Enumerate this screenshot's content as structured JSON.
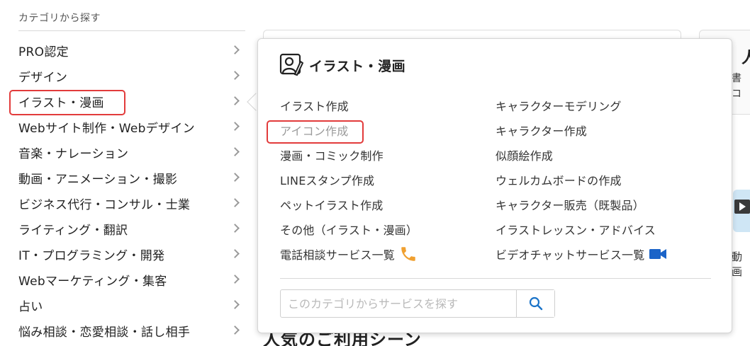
{
  "category_header": "カテゴリから探す",
  "categories": [
    {
      "label": "PRO認定"
    },
    {
      "label": "デザイン"
    },
    {
      "label": "イラスト・漫画",
      "active": true
    },
    {
      "label": "Webサイト制作・Webデザイン"
    },
    {
      "label": "音楽・ナレーション"
    },
    {
      "label": "動画・アニメーション・撮影"
    },
    {
      "label": "ビジネス代行・コンサル・士業"
    },
    {
      "label": "ライティング・翻訳"
    },
    {
      "label": "IT・プログラミング・開発"
    },
    {
      "label": "Webマーケティング・集客"
    },
    {
      "label": "占い"
    },
    {
      "label": "悩み相談・恋愛相談・話し相手"
    }
  ],
  "panel": {
    "title": "イラスト・漫画",
    "left_links": [
      {
        "label": "イラスト作成"
      },
      {
        "label": "アイコン作成"
      },
      {
        "label": "漫画・コミック制作"
      },
      {
        "label": "LINEスタンプ作成"
      },
      {
        "label": "ペットイラスト作成"
      },
      {
        "label": "その他（イラスト・漫画）"
      },
      {
        "label": "電話相談サービス一覧"
      }
    ],
    "right_links": [
      {
        "label": "キャラクターモデリング"
      },
      {
        "label": "キャラクター作成"
      },
      {
        "label": "似顔絵作成"
      },
      {
        "label": "ウェルカムボードの作成"
      },
      {
        "label": "キャラクター販売（既製品）"
      },
      {
        "label": "イラストレッスン・アドバイス"
      },
      {
        "label": "ビデオチャットサービス一覧"
      }
    ],
    "search": {
      "placeholder": "このカテゴリからサービスを探す",
      "value": ""
    }
  },
  "background": {
    "right_text_1": "人",
    "right_text_2": "書",
    "right_text_3": "コ",
    "right_text_4": "動画",
    "bottom_heading": "人気のご利用シーン"
  },
  "colors": {
    "highlight": "#e23b3b",
    "phone_icon": "#f0a030",
    "video_icon": "#1a63c8",
    "search_icon": "#1a73c8"
  }
}
